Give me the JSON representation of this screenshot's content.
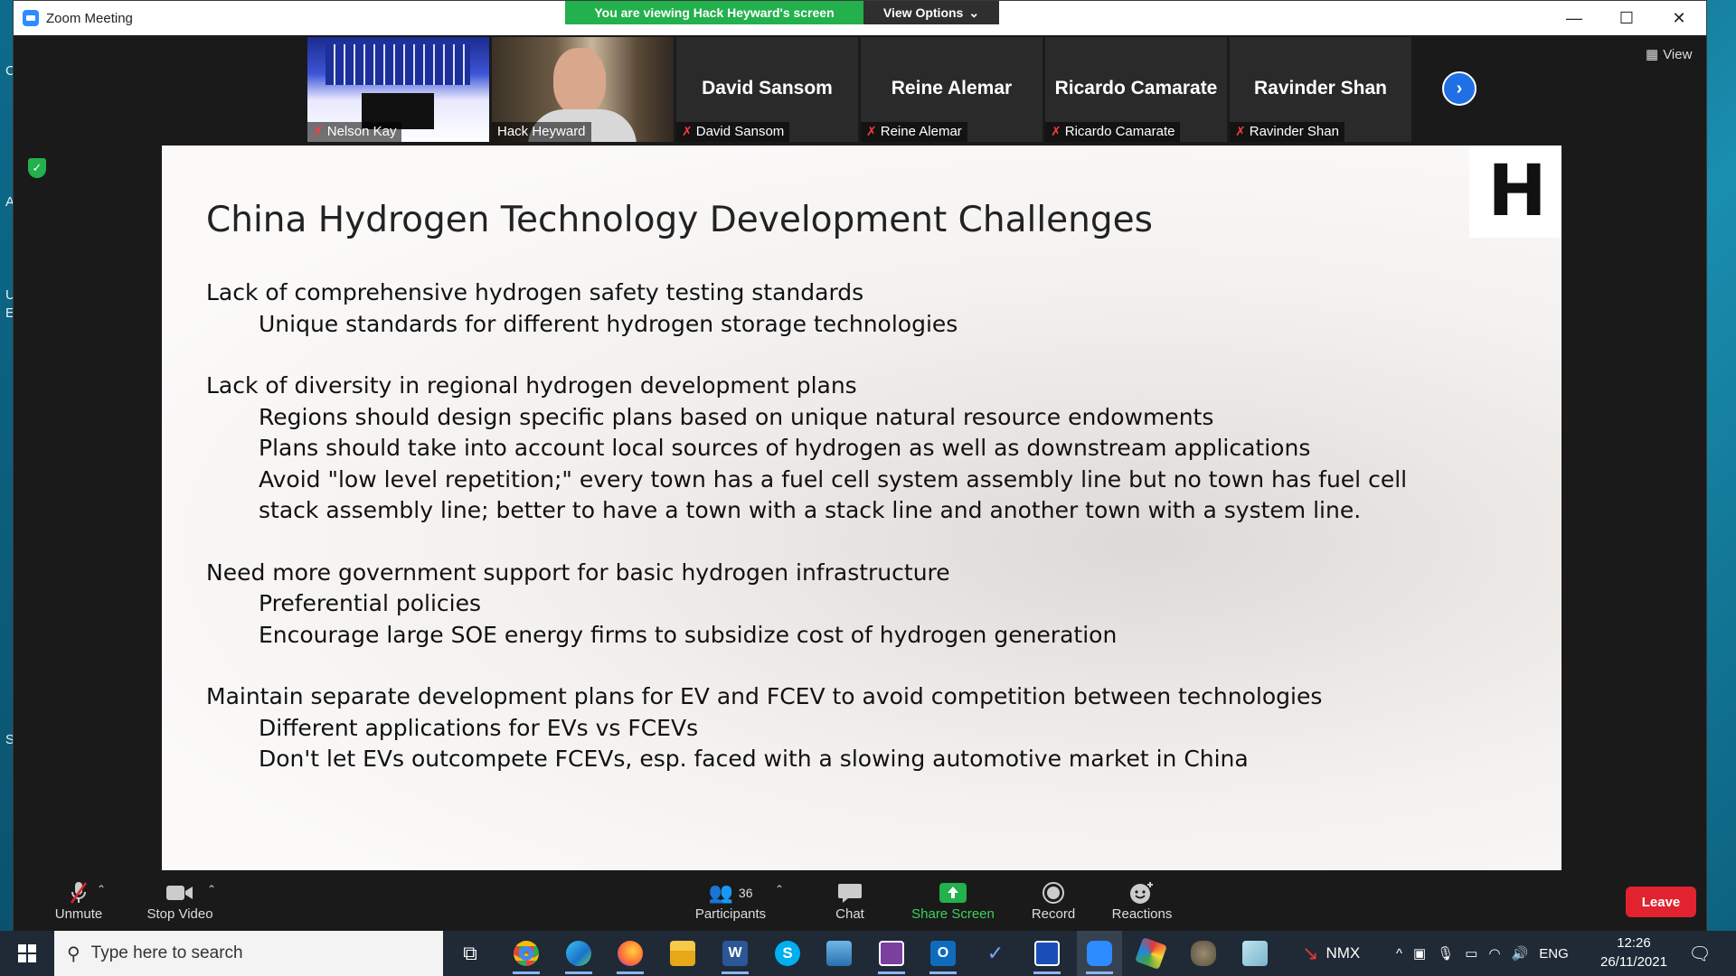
{
  "window": {
    "title": "Zoom Meeting"
  },
  "banner": {
    "viewing": "You are viewing Hack Heyward's screen",
    "view_options": "View Options"
  },
  "participants_strip": [
    {
      "name": "Nelson Kay",
      "display": "",
      "type": "image"
    },
    {
      "name": "Hack Heyward",
      "display": "",
      "type": "video"
    },
    {
      "name": "David Sansom",
      "display": "David Sansom",
      "type": "name"
    },
    {
      "name": "Reine Alemar",
      "display": "Reine Alemar",
      "type": "name"
    },
    {
      "name": "Ricardo Camarate",
      "display": "Ricardo Camarate",
      "type": "name"
    },
    {
      "name": "Ravinder Shan",
      "display": "Ravinder Shan",
      "type": "name"
    }
  ],
  "view_button": "View",
  "slide": {
    "logo": "H",
    "title": "China Hydrogen Technology Development Challenges",
    "groups": [
      {
        "heading": "Lack of comprehensive hydrogen safety testing standards",
        "items": [
          "Unique standards for different hydrogen storage technologies"
        ]
      },
      {
        "heading": "Lack of diversity in regional hydrogen development plans",
        "items": [
          "Regions should design specific plans based on unique natural resource endowments",
          "Plans should take into account local sources of hydrogen as well as downstream applications",
          "Avoid \"low level repetition;\" every town has a fuel cell system assembly line but no town has fuel cell stack assembly line; better to have a town with a stack line and another town with a system line."
        ]
      },
      {
        "heading": "Need more government support for basic hydrogen infrastructure",
        "items": [
          "Preferential policies",
          "Encourage large SOE energy firms to subsidize cost of hydrogen generation"
        ]
      },
      {
        "heading": "Maintain separate development plans for EV and FCEV to avoid competition between technologies",
        "items": [
          "Different applications for EVs vs FCEVs",
          "Don't let EVs outcompete FCEVs, esp. faced with a slowing automotive market in China"
        ]
      }
    ]
  },
  "toolbar": {
    "unmute": "Unmute",
    "stop_video": "Stop Video",
    "participants": "Participants",
    "participants_count": "36",
    "chat": "Chat",
    "share_screen": "Share Screen",
    "record": "Record",
    "reactions": "Reactions",
    "leave": "Leave"
  },
  "taskbar": {
    "search_placeholder": "Type here to search",
    "stock": "NMX",
    "language": "ENG",
    "time": "12:26",
    "date": "26/11/2021"
  },
  "colors": {
    "zoom_blue": "#2d8cff",
    "banner_green": "#23b14d",
    "leave_red": "#e0232f"
  }
}
